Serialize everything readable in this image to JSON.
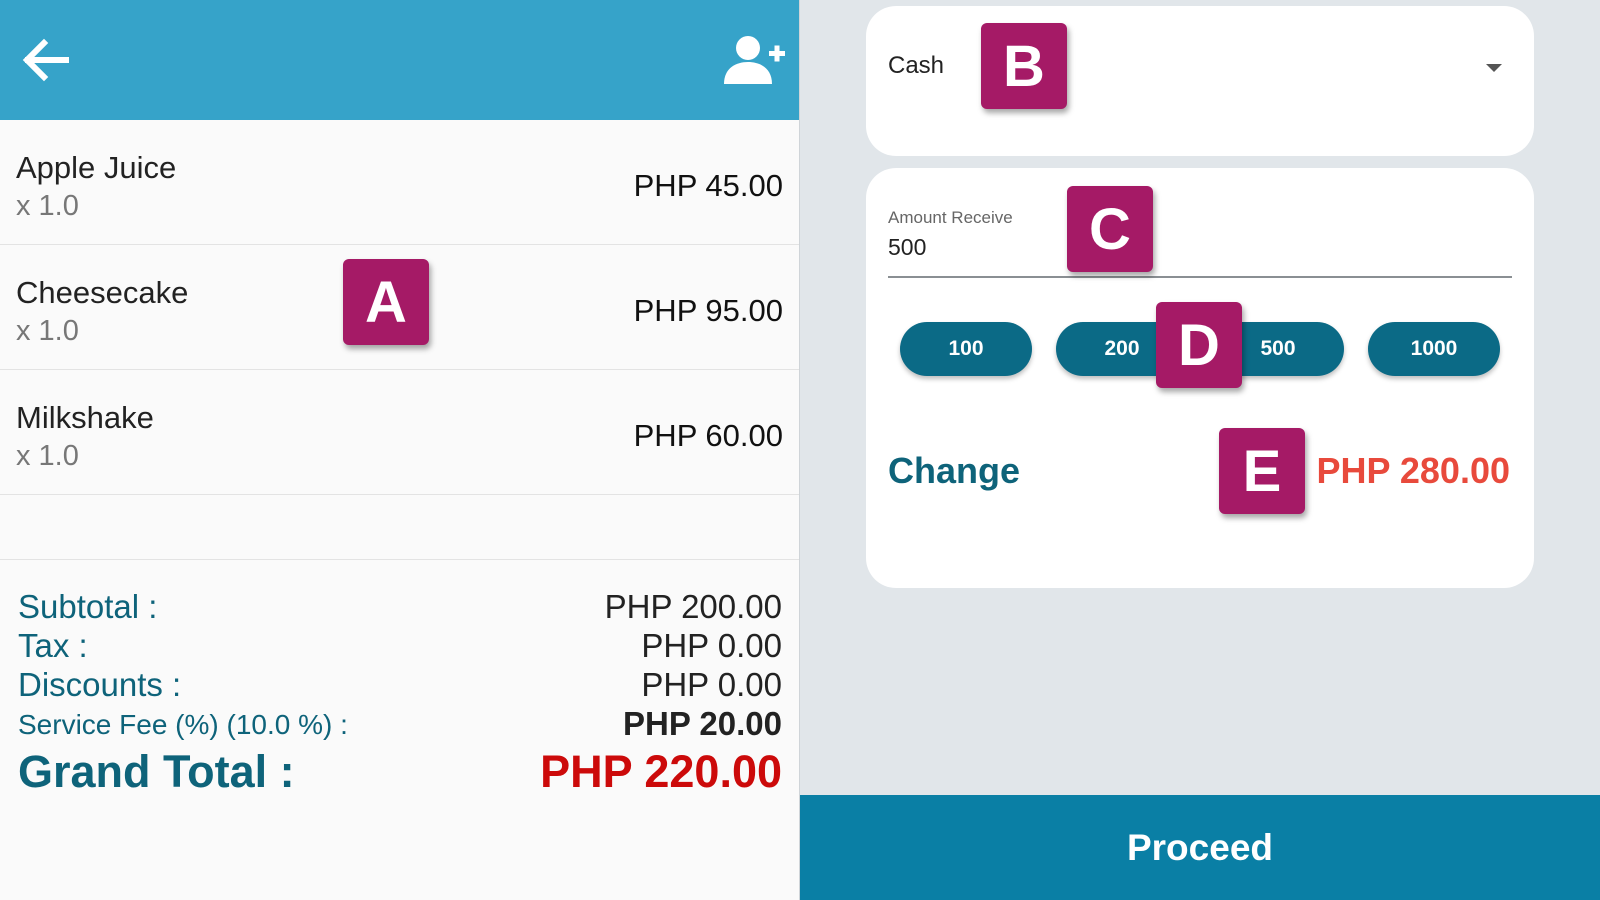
{
  "header": {
    "back_icon": "arrow-left-icon",
    "add_customer_icon": "person-add-icon",
    "bg_color": "#36a3c9"
  },
  "order_items": [
    {
      "name": "Apple Juice",
      "qty": "x 1.0",
      "price": "PHP 45.00"
    },
    {
      "name": "Cheesecake",
      "qty": "x 1.0",
      "price": "PHP 95.00"
    },
    {
      "name": "Milkshake",
      "qty": "x 1.0",
      "price": "PHP 60.00"
    }
  ],
  "summary": {
    "subtotal_label": "Subtotal :",
    "subtotal_value": "PHP 200.00",
    "tax_label": "Tax :",
    "tax_value": "PHP 0.00",
    "discounts_label": "Discounts :",
    "discounts_value": "PHP 0.00",
    "service_fee_label": "Service Fee (%) (10.0 %) :",
    "service_fee_value": "PHP 20.00",
    "grand_total_label": "Grand Total :",
    "grand_total_value": "PHP 220.00"
  },
  "payment": {
    "method_value": "Cash",
    "amount_label": "Amount Receive",
    "amount_value": "500",
    "quick_amounts": [
      "100",
      "200",
      "500",
      "1000"
    ],
    "change_label": "Change",
    "change_value": "PHP 280.00",
    "proceed_label": "Proceed"
  },
  "annotations": [
    "A",
    "B",
    "C",
    "D",
    "E"
  ],
  "colors": {
    "accent": "#0a7fa5",
    "label_teal": "#0e637a",
    "grand_total_red": "#cc0a0a",
    "change_red": "#e84a3c",
    "marker": "#a51a66"
  }
}
